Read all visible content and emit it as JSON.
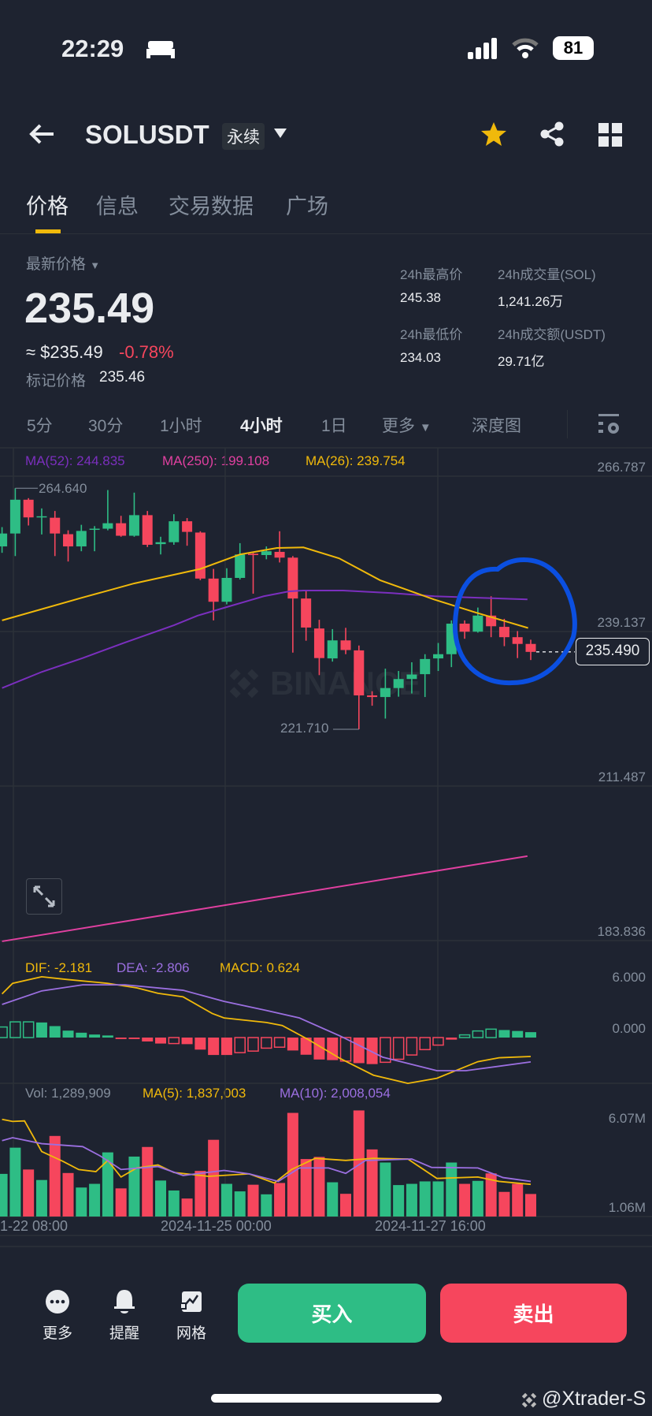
{
  "status": {
    "time": "22:29",
    "battery": "81"
  },
  "header": {
    "symbol": "SOLUSDT",
    "badge": "永续"
  },
  "tabs": [
    "价格",
    "信息",
    "交易数据",
    "广场"
  ],
  "price": {
    "label": "最新价格",
    "last": "235.49",
    "usd": "≈ $235.49",
    "change": "-0.78%",
    "mark_label": "标记价格",
    "mark": "235.46"
  },
  "stats": {
    "high_label": "24h最高价",
    "high": "245.38",
    "vol_label": "24h成交量(SOL)",
    "vol": "1,241.26万",
    "low_label": "24h最低价",
    "low": "234.03",
    "amt_label": "24h成交额(USDT)",
    "amt": "29.71亿"
  },
  "intervals": [
    "5分",
    "30分",
    "1小时",
    "4小时",
    "1日",
    "更多",
    "深度图"
  ],
  "active_interval": "4小时",
  "ma_legend": {
    "ma52": "MA(52): 244.835",
    "ma250": "MA(250): 199.108",
    "ma26": "MA(26): 239.754"
  },
  "price_axis": [
    "266.787",
    "239.137",
    "211.487",
    "183.836"
  ],
  "current_price_tag": "235.490",
  "hi_label": "264.640",
  "lo_label": "221.710",
  "watermark": "BINANCE",
  "macd_legend": {
    "dif": "DIF: -2.181",
    "dea": "DEA: -2.806",
    "macd": "MACD: 0.624"
  },
  "macd_axis": [
    "6.000",
    "0.000"
  ],
  "vol_legend": {
    "vol": "Vol: 1,289,909",
    "ma5": "MA(5): 1,837,003",
    "ma10": "MA(10): 2,008,054"
  },
  "vol_axis": [
    "6.07M",
    "1.06M"
  ],
  "time_axis": [
    "1-22 08:00",
    "2024-11-25 00:00",
    "2024-11-27 16:00"
  ],
  "bottom": {
    "more": "更多",
    "alert": "提醒",
    "grid": "网格",
    "buy": "买入",
    "sell": "卖出"
  },
  "user_watermark": "@Xtrader-S",
  "colors": {
    "up": "#2ebd85",
    "down": "#f6465d",
    "ma26": "#f0b90b",
    "ma52": "#7b2fbe",
    "ma250": "#e040a0",
    "dea": "#9b6fe0",
    "accent": "#f0b90b",
    "annotation": "#0b4fe0"
  },
  "chart_data": {
    "type": "candlestick",
    "ohlc": [
      [
        254.28,
        257.72,
        253.14,
        256.58
      ],
      [
        256.58,
        264.64,
        252.56,
        262.6
      ],
      [
        262.6,
        262.88,
        258.01,
        259.45
      ],
      [
        259.5,
        261.05,
        256.41,
        259.65
      ],
      [
        259.39,
        260.59,
        252.56,
        256.58
      ],
      [
        256.46,
        257.15,
        251.59,
        254.28
      ],
      [
        254.28,
        258.13,
        253.42,
        257.04
      ],
      [
        257.27,
        257.9,
        253.42,
        257.44
      ],
      [
        257.44,
        264.32,
        257.15,
        258.41
      ],
      [
        258.41,
        259.73,
        256.0,
        256.18
      ],
      [
        256.18,
        263.86,
        256.0,
        259.85
      ],
      [
        259.85,
        260.59,
        254.17,
        254.57
      ],
      [
        254.69,
        256.0,
        252.85,
        255.03
      ],
      [
        255.03,
        260.02,
        254.57,
        258.76
      ],
      [
        258.76,
        259.33,
        254.4,
        256.87
      ],
      [
        256.75,
        256.98,
        248.26,
        248.55
      ],
      [
        248.55,
        250.27,
        241.1,
        244.42
      ],
      [
        244.42,
        250.39,
        243.96,
        248.67
      ],
      [
        248.67,
        254.86,
        248.38,
        252.85
      ],
      [
        252.97,
        253.14,
        245.86,
        252.74
      ],
      [
        252.74,
        254.28,
        251.99,
        253.42
      ],
      [
        253.31,
        256.98,
        251.42,
        252.28
      ],
      [
        252.28,
        252.56,
        235.36,
        245.0
      ],
      [
        245.0,
        246.37,
        237.48,
        239.83
      ],
      [
        239.66,
        241.21,
        231.35,
        234.39
      ],
      [
        234.33,
        239.55,
        233.76,
        237.54
      ],
      [
        237.54,
        239.78,
        235.08,
        235.82
      ],
      [
        235.76,
        236.62,
        221.71,
        227.74
      ],
      [
        227.74,
        228.48,
        225.9,
        227.45
      ],
      [
        227.45,
        232.5,
        223.61,
        229.05
      ],
      [
        229.05,
        232.09,
        227.51,
        230.66
      ],
      [
        230.66,
        233.64,
        228.08,
        231.46
      ],
      [
        231.52,
        235.08,
        227.45,
        234.22
      ],
      [
        234.33,
        237.08,
        232.09,
        235.08
      ],
      [
        235.08,
        241.1,
        232.78,
        240.52
      ],
      [
        240.52,
        241.1,
        237.83,
        239.09
      ],
      [
        239.09,
        243.39,
        238.92,
        241.96
      ],
      [
        241.96,
        245.4,
        238.11,
        240.06
      ],
      [
        239.95,
        241.38,
        236.51,
        238.11
      ],
      [
        238.11,
        239.2,
        234.39,
        236.91
      ],
      [
        236.91,
        237.66,
        234.04,
        235.49
      ]
    ],
    "ma26": [
      [
        0,
        241.1
      ],
      [
        6,
        245.11
      ],
      [
        10,
        247.69
      ],
      [
        15,
        250.27
      ],
      [
        18,
        252.85
      ],
      [
        20.8,
        254.0
      ],
      [
        22.8,
        254.11
      ],
      [
        25.5,
        252.16
      ],
      [
        28.6,
        248.26
      ],
      [
        32.7,
        244.82
      ],
      [
        35.8,
        242.53
      ],
      [
        39.8,
        239.75
      ]
    ],
    "ma52": [
      [
        0,
        229.05
      ],
      [
        3,
        231.92
      ],
      [
        6.1,
        234.39
      ],
      [
        9.2,
        237.08
      ],
      [
        13,
        240.24
      ],
      [
        14.8,
        241.96
      ],
      [
        17.3,
        243.68
      ],
      [
        19.8,
        245.4
      ],
      [
        21.7,
        246.26
      ],
      [
        22.8,
        246.43
      ],
      [
        25.8,
        246.43
      ],
      [
        29.5,
        245.97
      ],
      [
        32.7,
        245.4
      ],
      [
        39.75,
        244.84
      ]
    ],
    "ma250": [
      [
        0,
        183.93
      ],
      [
        39.75,
        199.11
      ]
    ],
    "ylim": [
      183.836,
      266.787
    ],
    "macd_hist": [
      1.22,
      1.81,
      1.81,
      1.74,
      1.32,
      0.8,
      0.56,
      0.35,
      0.24,
      -0.17,
      -0.17,
      -0.45,
      -0.69,
      -0.69,
      -0.76,
      -1.39,
      -2.01,
      -2.01,
      -1.74,
      -1.56,
      -1.22,
      -1.11,
      -1.49,
      -1.98,
      -2.53,
      -2.6,
      -2.71,
      -2.95,
      -3.06,
      -2.85,
      -2.5,
      -2.01,
      -1.39,
      -0.87,
      -0.24,
      0.31,
      0.76,
      0.97,
      0.87,
      0.76,
      0.624
    ],
    "macd_hollow": [
      1,
      1,
      1,
      0,
      0,
      0,
      0,
      0,
      0,
      0,
      0,
      0,
      0,
      1,
      0,
      0,
      0,
      0,
      1,
      1,
      1,
      1,
      0,
      0,
      0,
      0,
      1,
      0,
      0,
      1,
      1,
      1,
      1,
      1,
      0,
      1,
      1,
      1,
      0,
      0,
      0
    ],
    "dif": [
      [
        0,
        5.03
      ],
      [
        0.8,
        6.25
      ],
      [
        3,
        7.01
      ],
      [
        4.9,
        6.7
      ],
      [
        8,
        6.25
      ],
      [
        10.2,
        5.73
      ],
      [
        11.8,
        5.1
      ],
      [
        13.7,
        4.69
      ],
      [
        15.9,
        2.78
      ],
      [
        16.8,
        2.26
      ],
      [
        20,
        1.74
      ],
      [
        21.2,
        1.39
      ],
      [
        23.1,
        -0.17
      ],
      [
        25.6,
        -2.43
      ],
      [
        28.1,
        -4.34
      ],
      [
        30.7,
        -5.28
      ],
      [
        32.9,
        -4.69
      ],
      [
        36,
        -2.78
      ],
      [
        37.6,
        -2.33
      ],
      [
        40,
        -2.18
      ]
    ],
    "dea": [
      [
        0,
        3.82
      ],
      [
        3,
        5.38
      ],
      [
        6.1,
        6.08
      ],
      [
        9.3,
        6.08
      ],
      [
        13.7,
        5.45
      ],
      [
        16.8,
        4.17
      ],
      [
        20,
        3.13
      ],
      [
        22.5,
        2.26
      ],
      [
        25.6,
        0.17
      ],
      [
        28.8,
        -2.26
      ],
      [
        32.9,
        -3.82
      ],
      [
        35.1,
        -3.82
      ],
      [
        40,
        -2.81
      ]
    ],
    "volume_m": [
      2.44,
      3.94,
      2.69,
      2.09,
      4.61,
      2.49,
      1.66,
      1.87,
      3.67,
      1.61,
      3.43,
      3.98,
      2.06,
      1.49,
      1.03,
      2.61,
      4.39,
      1.87,
      1.44,
      1.82,
      1.27,
      1.92,
      5.93,
      3.29,
      3.41,
      1.96,
      1.3,
      6.07,
      3.84,
      3.09,
      1.8,
      1.87,
      2.01,
      2.01,
      3.09,
      1.87,
      2.04,
      2.47,
      1.41,
      1.87,
      1.29
    ],
    "vol_ma5": [
      [
        0,
        5.56
      ],
      [
        0.8,
        5.44
      ],
      [
        1.7,
        5.47
      ],
      [
        3,
        3.72
      ],
      [
        4.6,
        3.16
      ],
      [
        5.8,
        2.69
      ],
      [
        7.1,
        2.57
      ],
      [
        8,
        3.21
      ],
      [
        9,
        2.26
      ],
      [
        10.2,
        2.78
      ],
      [
        11.8,
        2.95
      ],
      [
        13,
        2.52
      ],
      [
        15.6,
        2.3
      ],
      [
        18.7,
        2.44
      ],
      [
        20.6,
        1.92
      ],
      [
        21.9,
        2.69
      ],
      [
        23.7,
        3.33
      ],
      [
        26,
        3.21
      ],
      [
        28.1,
        3.33
      ],
      [
        30.7,
        3.29
      ],
      [
        32.9,
        2.18
      ],
      [
        36,
        2.26
      ],
      [
        37.6,
        2.01
      ],
      [
        40,
        1.84
      ]
    ],
    "vol_ma10": [
      [
        0,
        4.34
      ],
      [
        0.8,
        4.51
      ],
      [
        3,
        4.17
      ],
      [
        6.1,
        4.0
      ],
      [
        7.4,
        3.48
      ],
      [
        9,
        2.69
      ],
      [
        11.8,
        2.86
      ],
      [
        13.7,
        2.35
      ],
      [
        16.8,
        2.64
      ],
      [
        18.7,
        2.44
      ],
      [
        20.9,
        2.01
      ],
      [
        22.5,
        2.78
      ],
      [
        24.7,
        2.78
      ],
      [
        26,
        2.47
      ],
      [
        27.5,
        3.21
      ],
      [
        31,
        3.29
      ],
      [
        32.5,
        2.81
      ],
      [
        36,
        2.78
      ],
      [
        37.9,
        2.23
      ],
      [
        40,
        2.01
      ]
    ]
  }
}
